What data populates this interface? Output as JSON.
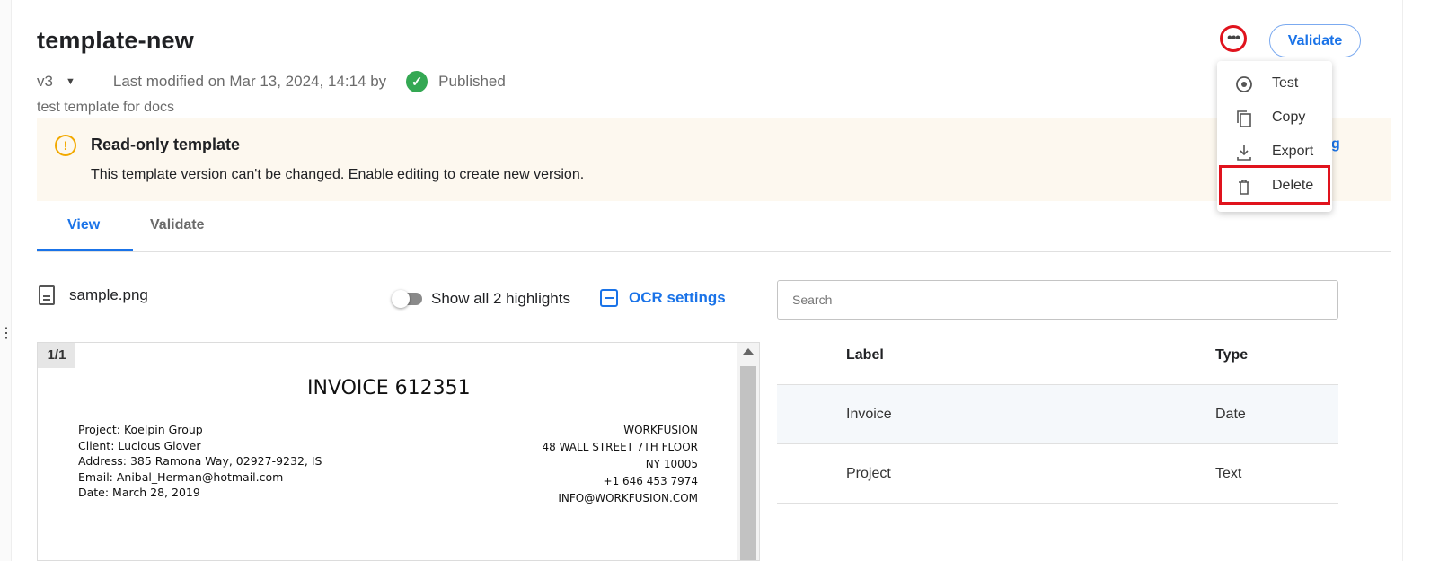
{
  "header": {
    "title": "template-new",
    "version": "v3",
    "last_modified": "Last modified on Mar 13, 2024, 14:14 by",
    "status": "Published",
    "description": "test template for docs"
  },
  "actions": {
    "more_label": "•••",
    "validate_label": "Validate"
  },
  "banner": {
    "title": "Read-only template",
    "text": "This template version can't be changed. Enable editing to create new version."
  },
  "tabs": [
    {
      "label": "View",
      "active": true
    },
    {
      "label": "Validate",
      "active": false
    }
  ],
  "toolbar": {
    "file_name": "sample.png",
    "toggle_label": "Show all 2 highlights",
    "ocr_label": "OCR settings",
    "search_placeholder": "Search"
  },
  "document": {
    "page_indicator": "1/1",
    "invoice_title": "INVOICE 612351",
    "left_lines": [
      "Project: Koelpin Group",
      "Client: Lucious Glover",
      "Address: 385 Ramona Way, 02927-9232, IS",
      "Email: Anibal_Herman@hotmail.com",
      "Date: March 28, 2019"
    ],
    "right_lines": [
      "WORKFUSION",
      "48 WALL STREET 7TH FLOOR",
      "NY 10005",
      "+1 646 453 7974",
      "INFO@WORKFUSION.COM"
    ]
  },
  "labels_table": {
    "headers": [
      "Label",
      "Type"
    ],
    "rows": [
      {
        "label": "Invoice",
        "type": "Date"
      },
      {
        "label": "Project",
        "type": "Text"
      }
    ]
  },
  "menu": {
    "items": [
      {
        "label": "Test",
        "icon": "target-icon"
      },
      {
        "label": "Copy",
        "icon": "copy-icon"
      },
      {
        "label": "Export",
        "icon": "download-icon"
      },
      {
        "label": "Delete",
        "icon": "trash-icon"
      }
    ]
  },
  "colors": {
    "accent": "#1a73e8",
    "highlight": "#e0131d",
    "success": "#34a853",
    "warning": "#f2a900",
    "banner_bg": "#fdf8ef"
  }
}
